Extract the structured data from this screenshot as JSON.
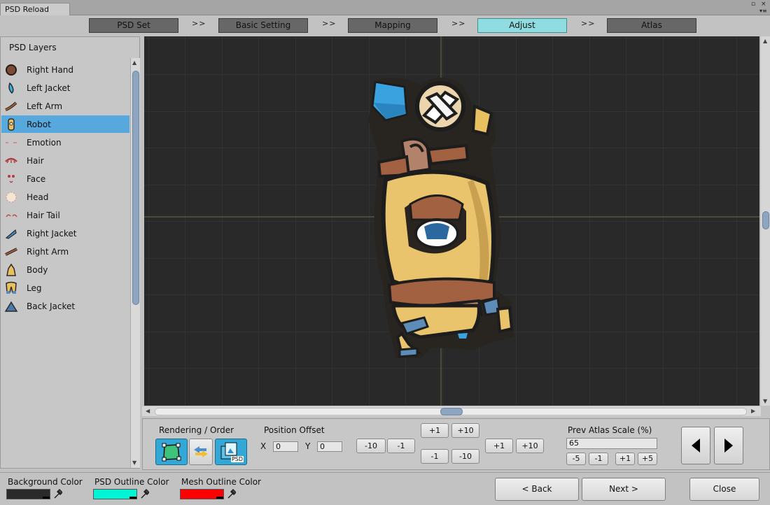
{
  "window": {
    "tab_title": "PSD Reload",
    "min_icon": "▫",
    "close_icon": "×"
  },
  "steps": [
    {
      "label": "PSD Set"
    },
    {
      "label": "Basic Setting"
    },
    {
      "label": "Mapping"
    },
    {
      "label": "Adjust"
    },
    {
      "label": "Atlas"
    }
  ],
  "step_separator": ">>",
  "layers_panel": {
    "title": "PSD Layers",
    "items": [
      {
        "label": "Right Hand",
        "icon": "right-hand-icon"
      },
      {
        "label": "Left Jacket",
        "icon": "left-jacket-icon"
      },
      {
        "label": "Left Arm",
        "icon": "left-arm-icon"
      },
      {
        "label": "Robot",
        "icon": "robot-icon",
        "selected": true
      },
      {
        "label": "Emotion",
        "icon": "emotion-icon"
      },
      {
        "label": "Hair",
        "icon": "hair-icon"
      },
      {
        "label": "Face",
        "icon": "face-icon"
      },
      {
        "label": "Head",
        "icon": "head-icon"
      },
      {
        "label": "Hair Tail",
        "icon": "hair-tail-icon"
      },
      {
        "label": "Right Jacket",
        "icon": "right-jacket-icon"
      },
      {
        "label": "Right Arm",
        "icon": "right-arm-icon"
      },
      {
        "label": "Body",
        "icon": "body-icon"
      },
      {
        "label": "Leg",
        "icon": "leg-icon"
      },
      {
        "label": "Back Jacket",
        "icon": "back-jacket-icon"
      }
    ]
  },
  "controls": {
    "rendering_label": "Rendering / Order",
    "position_label": "Position Offset",
    "x_label": "X",
    "y_label": "Y",
    "x_value": "0",
    "y_value": "0",
    "x_buttons": {
      "minus10": "-10",
      "minus1": "-1"
    },
    "y_up": {
      "plus1": "+1",
      "plus10": "+10"
    },
    "y_down": {
      "minus1": "-1",
      "minus10": "-10"
    },
    "x_plus": {
      "plus1": "+1",
      "plus10": "+10"
    },
    "scale_label": "Prev Atlas Scale (%)",
    "scale_value": "65",
    "scale_buttons": {
      "minus5": "-5",
      "minus1": "-1",
      "plus1": "+1",
      "plus5": "+5"
    },
    "psd_badge": "PSD"
  },
  "bottom": {
    "bg_color_label": "Background Color",
    "psd_outline_label": "PSD Outline Color",
    "mesh_outline_label": "Mesh Outline Color",
    "back_label": "< Back",
    "next_label": "Next >",
    "close_label": "Close"
  },
  "colors": {
    "background_color": "#2a2a2a",
    "psd_outline_color": "#00f5d4",
    "mesh_outline_color": "#ff0000",
    "active_step": "#8fdde0",
    "selected_row": "#56a8dd"
  }
}
